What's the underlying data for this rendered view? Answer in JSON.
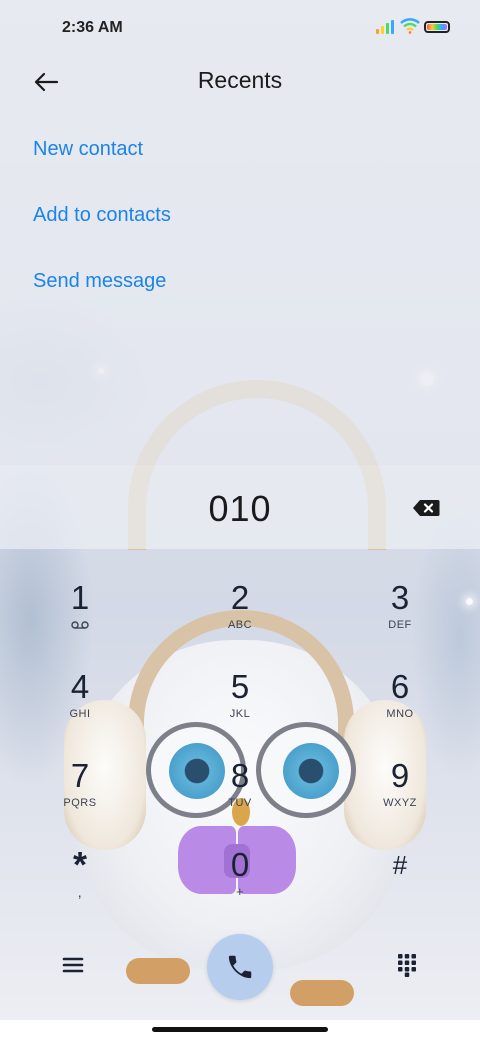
{
  "status_bar": {
    "time": "2:36 AM",
    "icons": [
      "signal-icon",
      "wifi-icon",
      "battery-icon"
    ]
  },
  "header": {
    "back_icon": "arrow-left-icon",
    "title": "Recents"
  },
  "actions": [
    {
      "label": "New contact"
    },
    {
      "label": "Add to contacts"
    },
    {
      "label": "Send message"
    }
  ],
  "dialer": {
    "number": "010",
    "backspace_icon": "backspace-icon"
  },
  "keypad": [
    {
      "digit": "1",
      "sub_icon": "voicemail-icon"
    },
    {
      "digit": "2",
      "letters": "ABC"
    },
    {
      "digit": "3",
      "letters": "DEF"
    },
    {
      "digit": "4",
      "letters": "GHI"
    },
    {
      "digit": "5",
      "letters": "JKL"
    },
    {
      "digit": "6",
      "letters": "MNO"
    },
    {
      "digit": "7",
      "letters": "PQRS"
    },
    {
      "digit": "8",
      "letters": "TUV"
    },
    {
      "digit": "9",
      "letters": "WXYZ"
    },
    {
      "digit": "*",
      "letters": ","
    },
    {
      "digit": "0",
      "letters": "+"
    },
    {
      "digit": "#",
      "letters": ""
    }
  ],
  "bottom_bar": {
    "menu_icon": "menu-icon",
    "call_icon": "phone-icon",
    "dialpad_icon": "dialpad-icon"
  },
  "colors": {
    "accent": "#1a84e8",
    "call_button": "#b7cdee"
  }
}
